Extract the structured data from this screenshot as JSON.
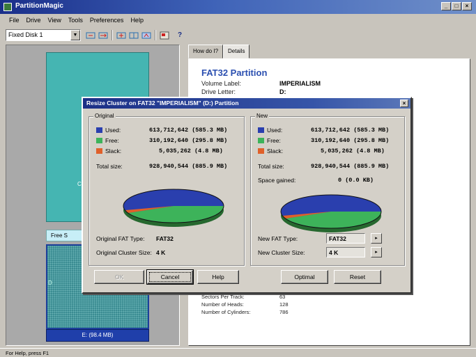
{
  "window": {
    "title": "PartitionMagic",
    "buttons": [
      "_",
      "□",
      "×"
    ]
  },
  "menubar": [
    "File",
    "Drive",
    "View",
    "Tools",
    "Preferences",
    "Help"
  ],
  "toolbar": {
    "disk_select": "Fixed Disk 1",
    "help_glyph": "?"
  },
  "disk_map": {
    "c_label": "C",
    "free_label": "Free S",
    "e_label": "D",
    "e_bar": "E: (98.4 MB)"
  },
  "tabs": [
    {
      "label": "How do I?"
    },
    {
      "label": "Details"
    }
  ],
  "details": {
    "title": "FAT32 Partition",
    "volume_label_label": "Volume Label:",
    "volume_label_value": "IMPERIALISM",
    "drive_letter_label": "Drive Letter:",
    "drive_letter_value": "D:",
    "rows": [
      {
        "label": "Sectors Per Track:",
        "value": "63"
      },
      {
        "label": "Number of Heads:",
        "value": "128"
      },
      {
        "label": "Number of Cylinders:",
        "value": "786"
      }
    ]
  },
  "status": "For Help, press F1",
  "dialog": {
    "title": "Resize Cluster on FAT32 \"IMPERIALISM\" (D:) Partition",
    "close": "×",
    "original": {
      "group_title": "Original",
      "used_label": "Used:",
      "used_value": "613,712,642  (585.3 MB)",
      "free_label": "Free:",
      "free_value": "310,192,640  (295.8 MB)",
      "slack_label": "Slack:",
      "slack_value": "5,035,262  (4.8 MB)",
      "total_label": "Total size:",
      "total_value": "928,940,544  (885.9 MB)",
      "fat_type_label": "Original FAT Type:",
      "fat_type_value": "FAT32",
      "cluster_label": "Original Cluster Size:",
      "cluster_value": "4 K"
    },
    "new": {
      "group_title": "New",
      "used_label": "Used:",
      "used_value": "613,712,642  (585.3 MB)",
      "free_label": "Free:",
      "free_value": "310,192,640  (295.8 MB)",
      "slack_label": "Slack:",
      "slack_value": "5,035,262  (4.8 MB)",
      "total_label": "Total size:",
      "total_value": "928,940,544  (885.9 MB)",
      "gained_label": "Space gained:",
      "gained_value": "0  (0.0 KB)",
      "fat_type_label": "New FAT Type:",
      "fat_type_value": "FAT32",
      "cluster_label": "New Cluster Size:",
      "cluster_value": "4 K",
      "spin_glyph": "▸"
    },
    "buttons": {
      "ok": "OK",
      "cancel": "Cancel",
      "help": "Help",
      "optimal": "Optimal",
      "reset": "Reset"
    }
  },
  "colors": {
    "used": "#2a3fae",
    "free": "#3db35a",
    "slack": "#e0602a"
  },
  "pie_fractions": {
    "used": 0.6607,
    "free": 0.3339,
    "slack": 0.0054
  }
}
